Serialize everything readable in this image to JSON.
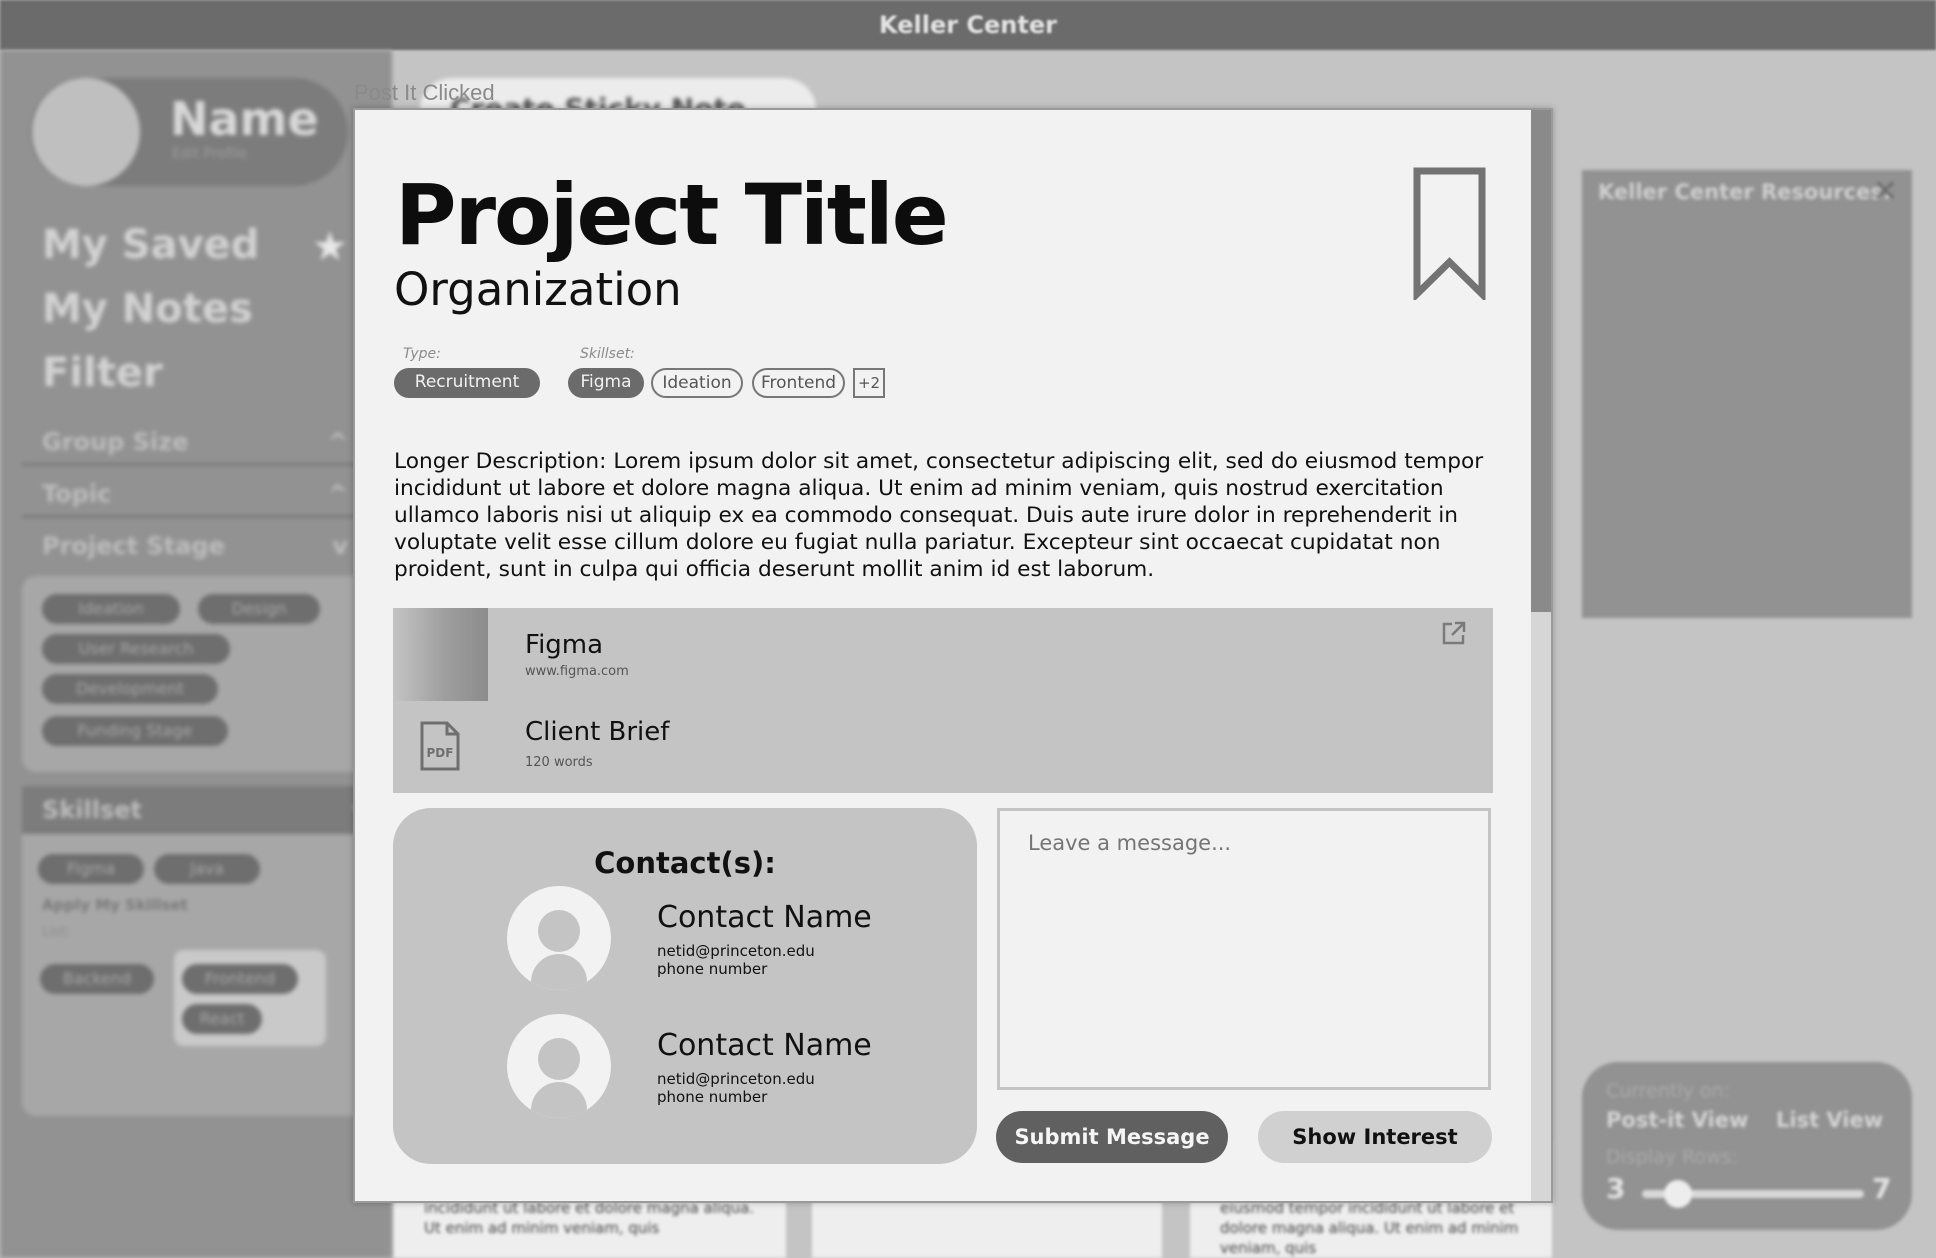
{
  "app": {
    "title": "Keller Center"
  },
  "sidebar": {
    "name": "Name",
    "edit_profile": "Edit Profile",
    "nav": [
      "My Saved",
      "My Notes",
      "Filter"
    ],
    "accordions": [
      "Group Size",
      "Topic",
      "Project Stage"
    ],
    "project_stage_tags": [
      "Ideation",
      "Design",
      "User Research",
      "Development",
      "Funding Stage"
    ],
    "skillset_label": "Skillset",
    "skillset_tags": [
      "Figma",
      "Java"
    ],
    "apply_label": "Apply My Skillset",
    "list_label": "List:",
    "list_tags": [
      "Backend",
      "Frontend",
      "React"
    ]
  },
  "state_label": "Post It Clicked",
  "sticky_button": "Create Sticky Note",
  "right_panel": {
    "resources_title": "Keller Center Resources:",
    "currently_on": "Currently on:",
    "post_it_view": "Post-it View",
    "list_view": "List View",
    "display_rows": "Display Rows:",
    "rows_min": "3",
    "rows_max": "7",
    "rows_value_fraction": 0.1
  },
  "modal": {
    "title": "Project Title",
    "organization": "Organization",
    "type_label": "Type:",
    "type_tag": "Recruitment",
    "skillset_label": "Skillset:",
    "skill_tags": [
      "Figma",
      "Ideation",
      "Frontend"
    ],
    "more_tag": "+2",
    "description": "Longer Description: Lorem ipsum dolor sit amet, consectetur adipiscing elit, sed do eiusmod tempor incididunt ut labore et dolore magna aliqua. Ut enim ad minim veniam, quis nostrud exercitation ullamco laboris nisi ut aliquip ex ea commodo consequat. Duis aute irure dolor in reprehenderit in voluptate velit esse cillum dolore eu fugiat nulla pariatur. Excepteur sint occaecat cupidatat non proident, sunt in culpa qui officia deserunt mollit anim id est laborum.",
    "resources": [
      {
        "title": "Figma",
        "subtitle": "www.figma.com"
      },
      {
        "title": "Client Brief",
        "subtitle": "120 words",
        "icon_label": "PDF"
      }
    ],
    "contacts_title": "Contact(s):",
    "contacts": [
      {
        "name": "Contact Name",
        "email": "netid@princeton.edu",
        "phone": "phone number"
      },
      {
        "name": "Contact Name",
        "email": "netid@princeton.edu",
        "phone": "phone number"
      }
    ],
    "message_placeholder": "Leave a message...",
    "submit_label": "Submit Message",
    "interest_label": "Show Interest"
  },
  "background_notes": [
    "Lorem ipsum dolor sit amet, consectetur adipiscing elit, sed do eiusmod tempor incididunt ut labore et dolore magna aliqua. Ut enim ad minim veniam, quis",
    "",
    "Lorem ipsum dolor sit amet, consectetur adipiscing elit, sed do eiusmod tempor incididunt ut labore et dolore magna aliqua. Ut enim ad minim veniam, quis"
  ]
}
